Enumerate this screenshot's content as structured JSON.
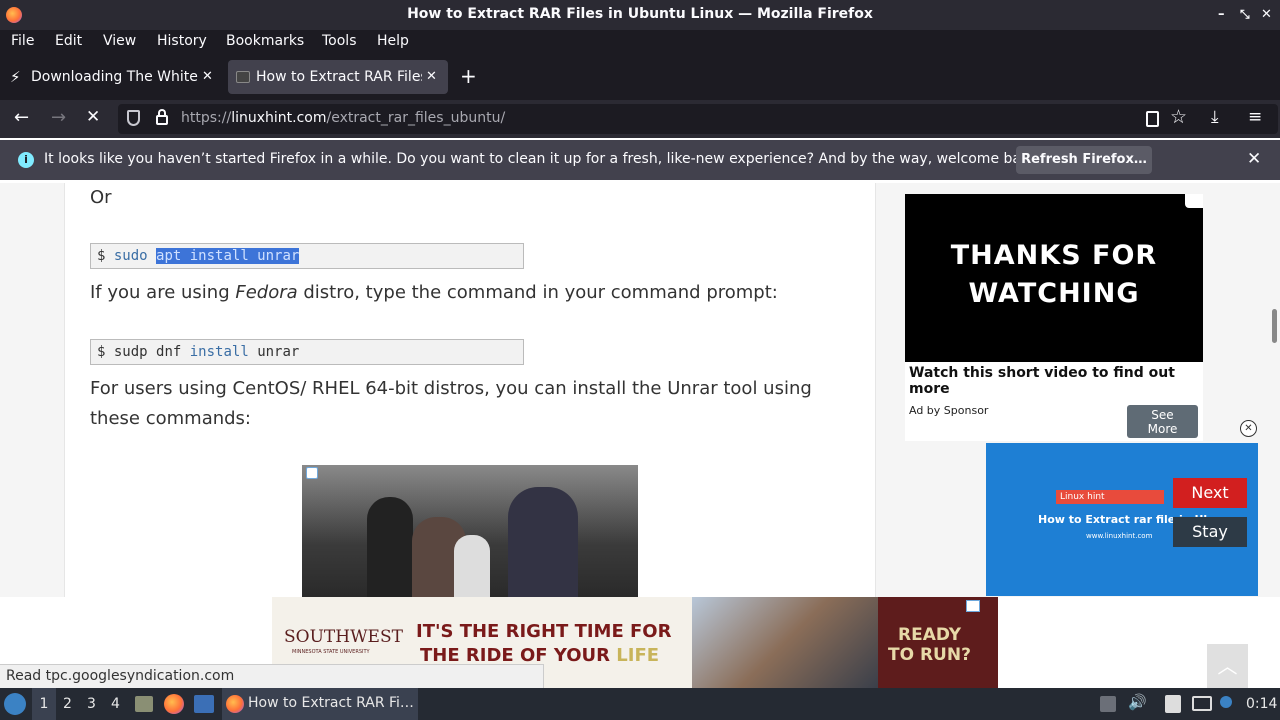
{
  "window": {
    "title": "How to Extract RAR Files in Ubuntu Linux — Mozilla Firefox"
  },
  "menu": {
    "file": "File",
    "edit": "Edit",
    "view": "View",
    "history": "History",
    "bookmarks": "Bookmarks",
    "tools": "Tools",
    "help": "Help"
  },
  "tabs": [
    {
      "title": "Downloading The White Noise"
    },
    {
      "title": "How to Extract RAR Files"
    }
  ],
  "address": {
    "scheme": "https://",
    "host": "linuxhint.com",
    "path": "/extract_rar_files_ubuntu/"
  },
  "notification": {
    "text": "It looks like you haven’t started Firefox in a while. Do you want to clean it up for a fresh, like-new experience? And by the way, welcome back!",
    "button": "Refresh Firefox…"
  },
  "article": {
    "or_text": "Or",
    "code1": {
      "prompt": "$",
      "cmd": "sudo",
      "selected": "apt install unrar"
    },
    "fedora": {
      "before": "If you are using ",
      "em": "Fedora",
      "after": " distro, type the command in your command prompt:"
    },
    "code2": {
      "prompt": "$",
      "cmd": "sudp dnf",
      "kw": "install",
      "arg": "unrar"
    },
    "centos_line1": "For users using CentOS/ RHEL 64-bit distros, you can install the Unrar tool using",
    "centos_line2": "these commands:"
  },
  "side_ad": {
    "video_line1": "THANKS FOR",
    "video_line2": "WATCHING",
    "headline": "Watch this short video to find out more",
    "sponsor": "Ad by Sponsor",
    "button": "See More"
  },
  "video_ad": {
    "brand": "Linux hint",
    "title": "How to Extract rar file in Ub",
    "url": "www.linuxhint.com",
    "next": "Next",
    "stay": "Stay"
  },
  "banner_ad": {
    "logo": "SOUTHWEST",
    "logo_sub": "MINNESOTA STATE UNIVERSITY",
    "line1": "IT'S THE RIGHT TIME FOR",
    "line2a": "THE RIDE OF YOUR ",
    "line2b": "LIFE",
    "cta1": "READY",
    "cta2": "TO RUN?"
  },
  "status": {
    "text": "Read tpc.googlesyndication.com"
  },
  "taskbar": {
    "workspaces": [
      "1",
      "2",
      "3",
      "4"
    ],
    "task": "How to Extract RAR Fi…",
    "clock": "0:14"
  },
  "colors": {
    "accent": "#3d74d8",
    "chrome_dark": "#1c1b22",
    "ad_blue": "#1e7fd4",
    "next_red": "#d21f1f"
  }
}
